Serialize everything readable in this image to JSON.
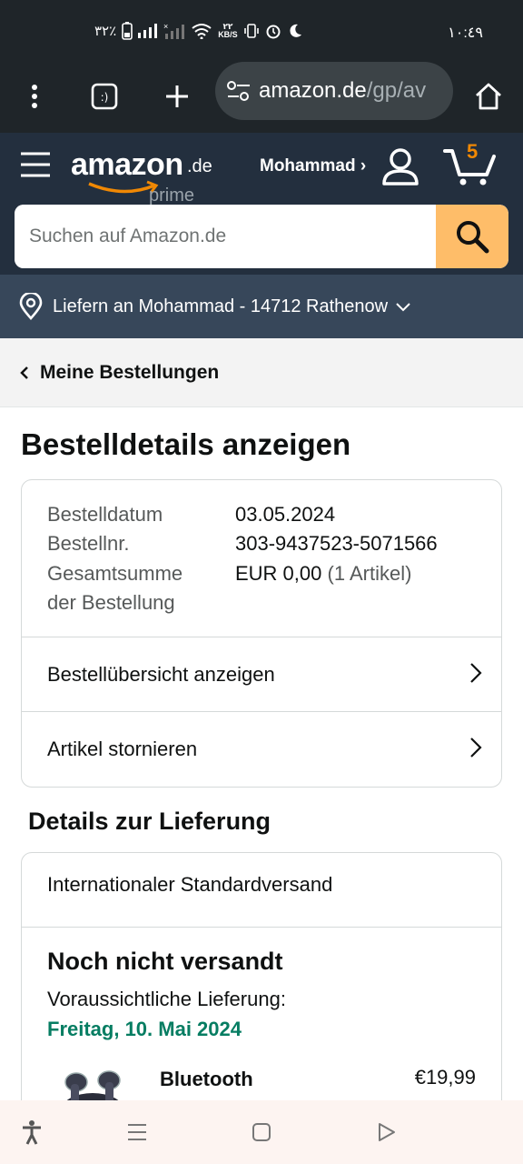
{
  "status_bar": {
    "time": "١٠:٤٩",
    "battery": "٣٢٪",
    "net_speed_value": "٢٢",
    "net_speed_unit": "KB/S"
  },
  "browser": {
    "url_host": "amazon.de",
    "url_path": "/gp/av",
    "icons": [
      "menu-dots-icon",
      "tabs-icon",
      "new-tab-icon",
      "site-settings-icon",
      "home-icon"
    ]
  },
  "header": {
    "logo_text": "amazon",
    "logo_tld": ".de",
    "logo_sub": "prime",
    "user_name": "Mohammad ›",
    "cart_count": "5",
    "search_placeholder": "Suchen auf Amazon.de"
  },
  "delivery": {
    "label": "Liefern an Mohammad - 14712 Rathenow"
  },
  "breadcrumb": {
    "label": "Meine Bestellungen"
  },
  "page": {
    "title": "Bestelldetails anzeigen"
  },
  "order": {
    "date_label": "Bestelldatum",
    "date_value": "03.05.2024",
    "number_label": "Bestellnr.",
    "number_value": "303-9437523-5071566",
    "total_label_1": "Gesamtsumme",
    "total_label_2": "der Bestellung",
    "total_value": "EUR 0,00",
    "total_items": "(1 Artikel)",
    "links": [
      "Bestellübersicht anzeigen",
      "Artikel stornieren"
    ]
  },
  "shipping": {
    "section_title": "Details zur Lieferung",
    "method": "Internationaler Standardversand",
    "status": "Noch nicht versandt",
    "expected_label": "Voraussichtliche Lieferung:",
    "expected_date": "Freitag, 10. Mai 2024",
    "product_name": "Bluetooth",
    "product_price": "€19,99"
  },
  "colors": {
    "header_bg": "#232f3e",
    "deliver_bg": "#37475a",
    "search_button": "#febd69",
    "cart_count": "#f08804",
    "delivery_date": "#067d62"
  }
}
